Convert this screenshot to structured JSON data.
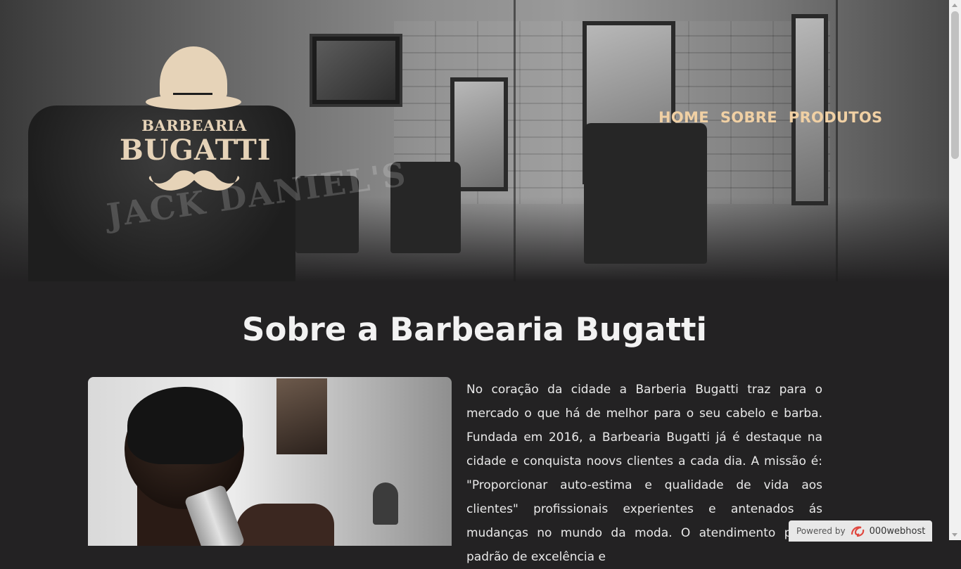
{
  "logo": {
    "line1": "BARBEARIA",
    "line2": "BUGATTI"
  },
  "nav": {
    "items": [
      {
        "label": "HOME"
      },
      {
        "label": "SOBRE"
      },
      {
        "label": "PRODUTOS"
      }
    ]
  },
  "hero": {
    "barrel_text": "JACK DANIEL'S"
  },
  "about": {
    "title": "Sobre a Barbearia Bugatti",
    "text": "No coração da cidade a Barberia Bugatti traz para o mercado o que há de melhor para o seu cabelo e barba. Fundada em 2016, a Barbearia Bugatti já é destaque na cidade e conquista noovs clientes a cada dia. A missão é: \"Proporcionar auto-estima e qualidade de vida aos clientes\" profissionais experientes e antenados ás mudanças no mundo da moda. O atendimento possui padrão de excelência e"
  },
  "badge": {
    "powered_by": "Powered by",
    "host": "000webhost"
  },
  "colors": {
    "accent": "#f0d0a4",
    "logo": "#e6d3b8",
    "background": "#232223"
  },
  "icons": {
    "hat": "bowler-hat-icon",
    "mustache": "mustache-icon",
    "host_logo": "000webhost-logo-icon"
  }
}
